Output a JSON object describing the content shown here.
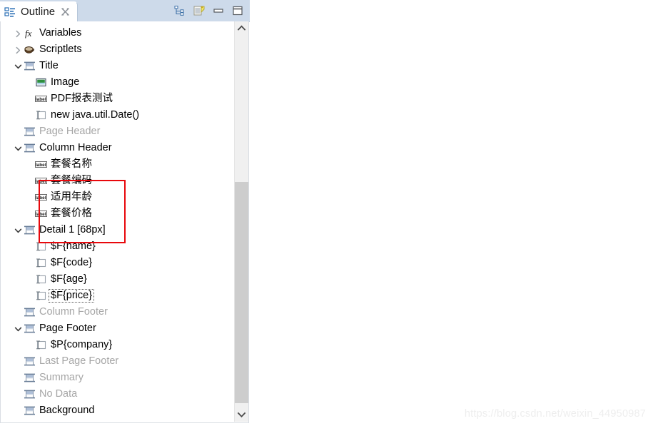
{
  "view": {
    "tab_label": "Outline",
    "tab_close_icon": "close-icon",
    "toolbar": [
      {
        "name": "collapse-all-icon",
        "title": "Collapse All"
      },
      {
        "name": "link-with-editor-icon",
        "title": "Link with Editor"
      },
      {
        "name": "minimize-icon",
        "title": "Minimize"
      },
      {
        "name": "maximize-icon",
        "title": "Maximize"
      }
    ]
  },
  "tree": {
    "rows": [
      {
        "label": "Variables",
        "icon": "function-icon",
        "twisty": "collapsed",
        "indent": 0,
        "dim": false,
        "selected": false
      },
      {
        "label": "Scriptlets",
        "icon": "scriptlet-icon",
        "twisty": "collapsed",
        "indent": 0,
        "dim": false,
        "selected": false
      },
      {
        "label": "Title",
        "icon": "band-icon",
        "twisty": "expanded",
        "indent": 0,
        "dim": false,
        "selected": false
      },
      {
        "label": "Image",
        "icon": "image-icon",
        "twisty": "none",
        "indent": 1,
        "dim": false,
        "selected": false
      },
      {
        "label": "PDF报表测试",
        "icon": "label-icon",
        "twisty": "none",
        "indent": 1,
        "dim": false,
        "selected": false
      },
      {
        "label": "new java.util.Date()",
        "icon": "textfield-icon",
        "twisty": "none",
        "indent": 1,
        "dim": false,
        "selected": false
      },
      {
        "label": "Page Header",
        "icon": "band-icon",
        "twisty": "none",
        "indent": 0,
        "dim": true,
        "selected": false
      },
      {
        "label": "Column Header",
        "icon": "band-icon",
        "twisty": "expanded",
        "indent": 0,
        "dim": false,
        "selected": false
      },
      {
        "label": "套餐名称",
        "icon": "label-icon",
        "twisty": "none",
        "indent": 1,
        "dim": false,
        "selected": false
      },
      {
        "label": "套餐编码",
        "icon": "label-icon",
        "twisty": "none",
        "indent": 1,
        "dim": false,
        "selected": false
      },
      {
        "label": "适用年龄",
        "icon": "label-icon",
        "twisty": "none",
        "indent": 1,
        "dim": false,
        "selected": false
      },
      {
        "label": "套餐价格",
        "icon": "label-icon",
        "twisty": "none",
        "indent": 1,
        "dim": false,
        "selected": false
      },
      {
        "label": "Detail 1 [68px]",
        "icon": "band-icon",
        "twisty": "expanded",
        "indent": 0,
        "dim": false,
        "selected": false
      },
      {
        "label": "$F{name}",
        "icon": "textfield-icon",
        "twisty": "none",
        "indent": 1,
        "dim": false,
        "selected": false
      },
      {
        "label": "$F{code}",
        "icon": "textfield-icon",
        "twisty": "none",
        "indent": 1,
        "dim": false,
        "selected": false
      },
      {
        "label": "$F{age}",
        "icon": "textfield-icon",
        "twisty": "none",
        "indent": 1,
        "dim": false,
        "selected": false
      },
      {
        "label": "$F{price}",
        "icon": "textfield-icon",
        "twisty": "none",
        "indent": 1,
        "dim": false,
        "selected": true
      },
      {
        "label": "Column Footer",
        "icon": "band-icon",
        "twisty": "none",
        "indent": 0,
        "dim": true,
        "selected": false
      },
      {
        "label": "Page Footer",
        "icon": "band-icon",
        "twisty": "expanded",
        "indent": 0,
        "dim": false,
        "selected": false
      },
      {
        "label": "$P{company}",
        "icon": "textfield-icon",
        "twisty": "none",
        "indent": 1,
        "dim": false,
        "selected": false
      },
      {
        "label": "Last Page Footer",
        "icon": "band-icon",
        "twisty": "none",
        "indent": 0,
        "dim": true,
        "selected": false
      },
      {
        "label": "Summary",
        "icon": "band-icon",
        "twisty": "none",
        "indent": 0,
        "dim": true,
        "selected": false
      },
      {
        "label": "No Data",
        "icon": "band-icon",
        "twisty": "none",
        "indent": 0,
        "dim": true,
        "selected": false
      },
      {
        "label": "Background",
        "icon": "band-icon",
        "twisty": "none",
        "indent": 0,
        "dim": false,
        "selected": false
      }
    ]
  },
  "scrollbar": {
    "up_icon": "chevron-up-icon",
    "down_icon": "chevron-down-icon"
  },
  "annotation": {
    "color": "#e8080c",
    "shape": "rectangle"
  },
  "watermark": {
    "text": "https://blog.csdn.net/weixin_44950987"
  },
  "colors": {
    "tabbar": "#cddaea",
    "annotation_red": "#e8080c",
    "scroll_thumb": "#cdcdcd",
    "dim_text": "#a6a6a6"
  }
}
